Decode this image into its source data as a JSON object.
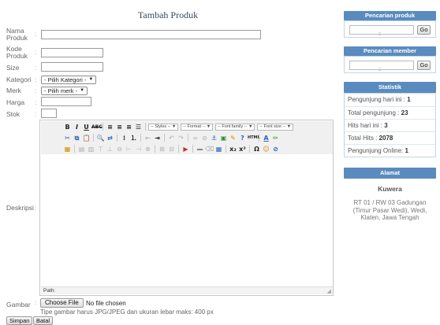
{
  "form": {
    "title": "Tambah Produk",
    "labels": {
      "nama_line1": "Nama",
      "nama_line2": "Produk",
      "kode_line1": "Kode",
      "kode_line2": "Produk",
      "size": "Size",
      "kategori": "Kategori",
      "merk": "Merk",
      "harga": "Harga",
      "stok": "Stok",
      "deskripsi": "Deskripsi",
      "gambar": "Gambar"
    },
    "colon": ":",
    "values": {
      "nama_produk": "",
      "kode_produk": "",
      "size": "",
      "harga": "",
      "stok": ""
    },
    "kategori_selected": "- Pilih Kategori -",
    "merk_selected": "- Pilih merk -",
    "file_button": "Choose File",
    "file_status": "No file chosen",
    "file_hint": "Tipe gambar harus JPG/JPEG dan ukuran lebar maks: 400 px",
    "save_label": "Simpan",
    "cancel_label": "Batal"
  },
  "editor": {
    "styles_select": "-- Styles --",
    "format_select": "-- Format --",
    "font_family_select": "-- Font family --",
    "font_size_select": "-- Font size --",
    "path_label": "Path:"
  },
  "sidebar": {
    "search_product": {
      "title": "Pencarian produk",
      "value": "",
      "go_label": "Go"
    },
    "search_member": {
      "title": "Pencarian member",
      "value": "",
      "go_label": "Go"
    },
    "stats": {
      "title": "Statistik",
      "rows": [
        {
          "label": "Pengunjung hari ini :",
          "value": "1"
        },
        {
          "label": "Total pengunjung :",
          "value": "23"
        },
        {
          "label": "Hits hari ini :",
          "value": "3"
        },
        {
          "label": "Total Hits :",
          "value": "2078"
        },
        {
          "label": "Pengunjung Online:",
          "value": "1"
        }
      ]
    },
    "address": {
      "title": "Alamat",
      "name": "Kuwera",
      "text": "RT 01 / RW 03 Gadungan (Timur Pasar Wedi), Wedi, Klaten, Jawa Tengah"
    }
  },
  "colors": {
    "sidebar_header": "#5a8bbf",
    "title_text": "#3a4a5c",
    "label_text": "#666666"
  }
}
